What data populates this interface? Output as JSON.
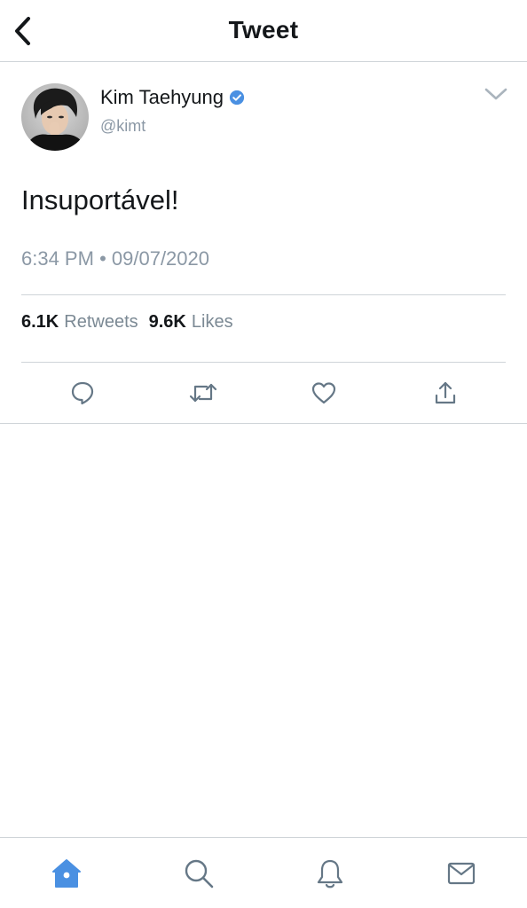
{
  "header": {
    "title": "Tweet",
    "back_icon": "chevron-left-icon"
  },
  "tweet": {
    "display_name": "Kim Taehyung",
    "verified": true,
    "handle": "@kimt",
    "text": "Insuportável!",
    "time": "6:34 PM",
    "separator": "•",
    "date": "09/07/2020",
    "stats": {
      "retweets_count": "6.1K",
      "retweets_label": "Retweets",
      "likes_count": "9.6K",
      "likes_label": "Likes"
    },
    "actions": [
      "reply-icon",
      "retweet-icon",
      "like-icon",
      "share-icon"
    ]
  },
  "tabbar": {
    "tabs": [
      "home-icon",
      "search-icon",
      "notifications-icon",
      "messages-icon"
    ],
    "active": "home-icon"
  },
  "colors": {
    "accent": "#4a90e2",
    "text_primary": "#14171a",
    "text_secondary": "#8b98a5",
    "icon_gray": "#657786",
    "divider": "#cfd4d8"
  }
}
